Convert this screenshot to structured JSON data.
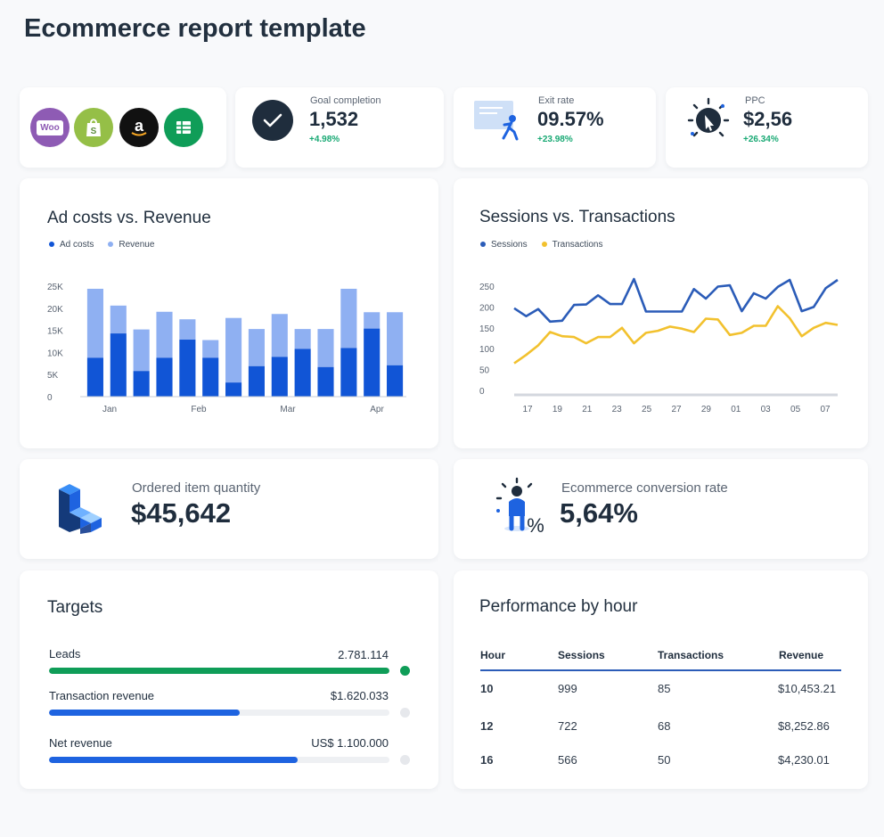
{
  "page": {
    "title": "Ecommerce report template"
  },
  "integrations": {
    "woo": "Woo"
  },
  "kpis": [
    {
      "label": "Goal completion",
      "value": "1,532",
      "delta": "+4.98%"
    },
    {
      "label": "Exit rate",
      "value": "09.57%",
      "delta": "+23.98%"
    },
    {
      "label": "PPC",
      "value": "$2,56",
      "delta": "+26.34%"
    }
  ],
  "colors": {
    "dark_blue": "#1155d6",
    "light_blue": "#8fb0f2",
    "sessions": "#2b5cb8",
    "transactions": "#f2c12e",
    "green": "#0f9d58",
    "bar_blue": "#1e63e0"
  },
  "chart_data": [
    {
      "type": "bar",
      "stacked": true,
      "title": "Ad costs vs. Revenue",
      "legend": [
        "Ad costs",
        "Revenue"
      ],
      "x_tick_labels": [
        "Jan",
        "Feb",
        "Mar",
        "Apr"
      ],
      "y_tick_labels": [
        "0",
        "5K",
        "10K",
        "15K",
        "20K",
        "25K"
      ],
      "ylim": [
        0,
        25000
      ],
      "series": [
        {
          "name": "Ad costs",
          "values": [
            8800,
            14300,
            5800,
            8800,
            12900,
            8800,
            3200,
            6900,
            9000,
            10800,
            6700,
            11000,
            15400,
            7100
          ]
        },
        {
          "name": "Revenue",
          "values": [
            15600,
            6300,
            9400,
            10400,
            4600,
            4000,
            14600,
            8400,
            9700,
            4500,
            8600,
            13400,
            3700,
            12000
          ]
        }
      ]
    },
    {
      "type": "line",
      "title": "Sessions vs. Transactions",
      "legend": [
        "Sessions",
        "Transactions"
      ],
      "x_tick_labels": [
        "17",
        "19",
        "21",
        "23",
        "25",
        "27",
        "29",
        "01",
        "03",
        "05",
        "07"
      ],
      "y_tick_labels": [
        "0",
        "50",
        "100",
        "150",
        "200",
        "250"
      ],
      "ylim": [
        0,
        250
      ],
      "series": [
        {
          "name": "Sessions",
          "values": [
            197,
            178,
            195,
            165,
            167,
            205,
            206,
            228,
            207,
            207,
            267,
            189,
            189,
            189,
            189,
            243,
            220,
            249,
            252,
            190,
            233,
            220,
            248,
            265,
            190,
            200,
            245,
            265
          ]
        },
        {
          "name": "Transactions",
          "values": [
            65,
            85,
            108,
            140,
            130,
            128,
            113,
            128,
            128,
            150,
            113,
            138,
            143,
            153,
            148,
            140,
            172,
            170,
            133,
            138,
            155,
            155,
            202,
            173,
            130,
            150,
            162,
            157
          ]
        }
      ]
    }
  ],
  "stats": [
    {
      "label": "Ordered item quantity",
      "value": "$45,642"
    },
    {
      "label": "Ecommerce conversion rate",
      "value": "5,64%",
      "icon_glyph": "%"
    }
  ],
  "targets": {
    "title": "Targets",
    "items": [
      {
        "label": "Leads",
        "value": "2.781.114",
        "progress": 1.0,
        "color": "#0f9d58",
        "complete": true
      },
      {
        "label": "Transaction revenue",
        "value": "$1.620.033",
        "progress": 0.56,
        "color": "#1e63e0",
        "complete": false
      },
      {
        "label": "Net revenue",
        "value": "US$ 1.100.000",
        "progress": 0.73,
        "color": "#1e63e0",
        "complete": false
      }
    ]
  },
  "performance": {
    "title": "Performance by hour",
    "columns": [
      "Hour",
      "Sessions",
      "Transactions",
      "Revenue"
    ],
    "rows": [
      [
        "10",
        "999",
        "85",
        "$10,453.21"
      ],
      [
        "12",
        "722",
        "68",
        "$8,252.86"
      ],
      [
        "16",
        "566",
        "50",
        "$4,230.01"
      ]
    ]
  }
}
